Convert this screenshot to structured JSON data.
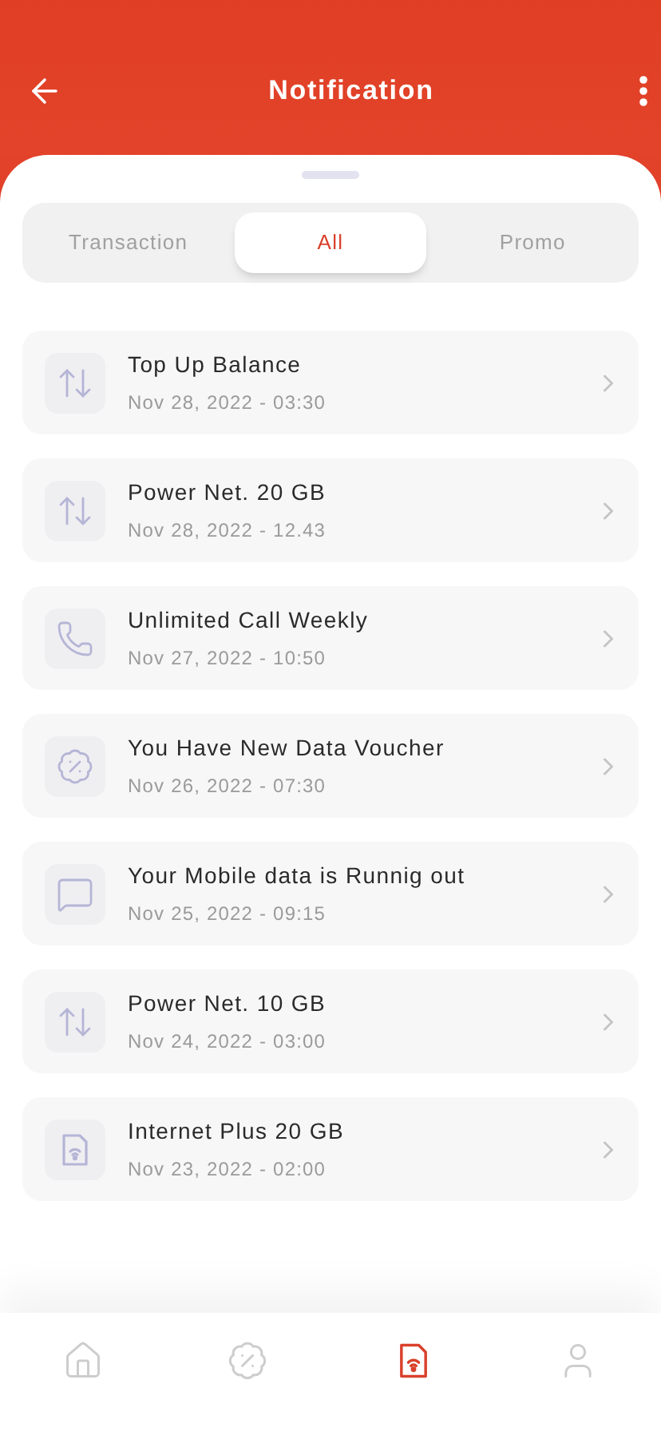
{
  "header": {
    "title": "Notification"
  },
  "tabs": [
    {
      "label": "Transaction",
      "selected": false
    },
    {
      "label": "All",
      "selected": true
    },
    {
      "label": "Promo",
      "selected": false
    }
  ],
  "notifications": [
    {
      "kind": "transfer",
      "title": "Top Up Balance",
      "time": "Nov 28, 2022 - 03:30"
    },
    {
      "kind": "transfer",
      "title": "Power Net. 20 GB",
      "time": "Nov 28, 2022 - 12.43"
    },
    {
      "kind": "call",
      "title": "Unlimited Call Weekly",
      "time": "Nov 27, 2022 - 10:50"
    },
    {
      "kind": "voucher",
      "title": "You Have New Data Voucher",
      "time": "Nov 26, 2022 - 07:30"
    },
    {
      "kind": "message",
      "title": "Your Mobile data is Runnig out",
      "time": "Nov 25, 2022 - 09:15"
    },
    {
      "kind": "transfer",
      "title": "Power Net. 10 GB",
      "time": "Nov 24, 2022 - 03:00"
    },
    {
      "kind": "sim",
      "title": "Internet Plus 20 GB",
      "time": "Nov 23, 2022 - 02:00"
    }
  ],
  "bottom_nav": [
    {
      "kind": "home",
      "selected": false
    },
    {
      "kind": "voucher",
      "selected": false
    },
    {
      "kind": "sim",
      "selected": true
    },
    {
      "kind": "profile",
      "selected": false
    }
  ]
}
